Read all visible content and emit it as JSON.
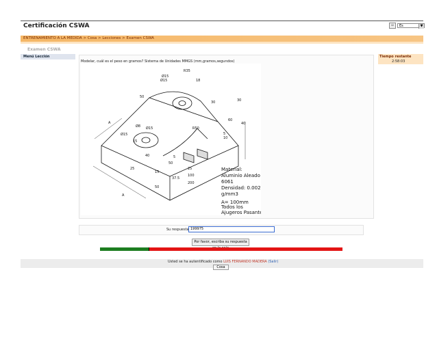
{
  "header": {
    "title": "Certificación CSWA",
    "lang_btn": "▫",
    "lang_value": "Es"
  },
  "breadcrumb": {
    "items": [
      "ENTRENAMIENTO A LA MEDIDA",
      "Cosa",
      "Lecciones",
      "Examen CSWA"
    ],
    "separator": " > "
  },
  "page_heading": "Examen CSWA",
  "side_menu": {
    "title": "Menú Lección"
  },
  "timer": {
    "label": "Tiempo restante",
    "value": "2:58:03"
  },
  "question": {
    "text": "Modelar, cuál es el peso en gramos? Sistema de Unidades MMGS (mm,gramos,segundos)",
    "figure": {
      "dims": [
        "R35",
        "Ø15",
        "Ø15",
        "18",
        "50",
        "30",
        "30",
        "60",
        "40",
        "A",
        "R50",
        "Ø15",
        "Ø8",
        "Ø15",
        "15",
        "40",
        "5",
        "50",
        "25",
        "15",
        "25",
        "100",
        "37.5",
        "200",
        "50",
        "A",
        "5",
        "10"
      ],
      "material_lines": [
        "Material:",
        "Aluminio Aleado",
        "6061",
        "Densidad: 0.0027",
        "g/mm3",
        "",
        "A= 100mm",
        "Todos los",
        "Ajugeros Pasantes"
      ]
    }
  },
  "answer": {
    "label": "Su respuesta:",
    "value": "199975"
  },
  "submit": {
    "label": "Por favor, escriba su respuesta en la caja"
  },
  "progress": {
    "fraction": 0.2
  },
  "footer": {
    "prefix": "Usted se ha autentificado como",
    "user": "LUIS FERNANDO MADERA",
    "logout": "(Salir)",
    "button": "Cosa"
  },
  "colors": {
    "nav": "#f5b766",
    "progress_done": "#1d7d20",
    "progress_remaining": "#e31515",
    "input_border": "#3a6bd2"
  }
}
